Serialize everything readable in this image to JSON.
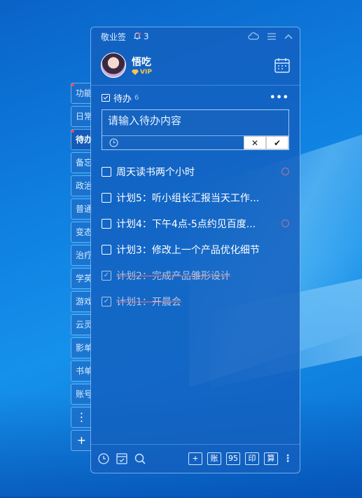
{
  "app": {
    "title": "敬业签",
    "notifications": "3"
  },
  "user": {
    "name": "悟吃",
    "badge": "VIP"
  },
  "side_tabs": [
    {
      "label": "功能",
      "dot": true
    },
    {
      "label": "日常",
      "dot": false
    },
    {
      "label": "待办",
      "dot": true,
      "active": true
    },
    {
      "label": "备忘",
      "dot": false
    },
    {
      "label": "政治",
      "dot": false
    },
    {
      "label": "普通",
      "dot": false
    },
    {
      "label": "变态",
      "dot": false
    },
    {
      "label": "治疗",
      "dot": false
    },
    {
      "label": "学英",
      "dot": false
    },
    {
      "label": "游戏",
      "dot": false
    },
    {
      "label": "云灵",
      "dot": false
    },
    {
      "label": "影单",
      "dot": false
    },
    {
      "label": "书单",
      "dot": false
    },
    {
      "label": "账号",
      "dot": false
    }
  ],
  "section": {
    "title": "待办",
    "count": "6",
    "more": "•••"
  },
  "input": {
    "placeholder": "请输入待办内容",
    "cancel": "✕",
    "confirm": "✔"
  },
  "todos": [
    {
      "text": "周天读书两个小时",
      "done": false,
      "reminder": true
    },
    {
      "text": "计划5：听小组长汇报当天工作...",
      "done": false,
      "reminder": false
    },
    {
      "text": "计划4：下午4点-5点约见百度...",
      "done": false,
      "reminder": true
    },
    {
      "text": "计划3：修改上一个产品优化细节",
      "done": false,
      "reminder": false
    },
    {
      "text": "计划2：完成产品雏形设计",
      "done": true,
      "reminder": false
    },
    {
      "text": "计划1：开晨会",
      "done": true,
      "reminder": false
    }
  ],
  "bottom": {
    "buttons": [
      "+",
      "账",
      "95",
      "印",
      "算"
    ]
  },
  "side_extra": {
    "more": "⋮",
    "add": "+"
  }
}
